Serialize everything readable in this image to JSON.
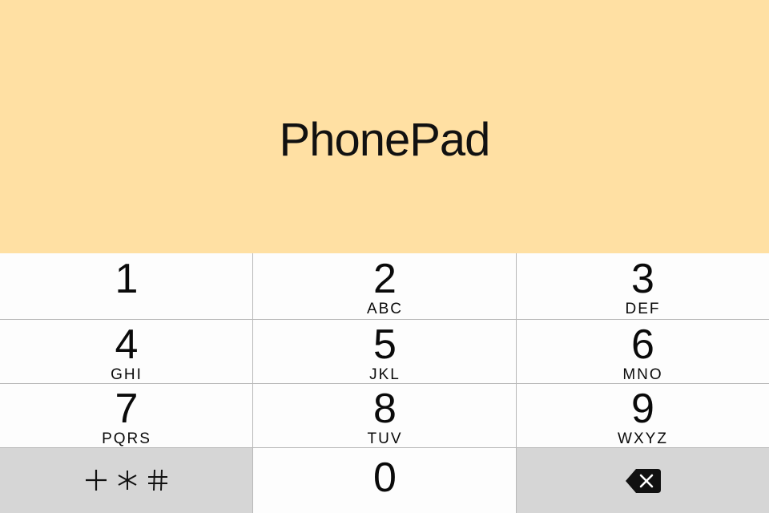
{
  "app": {
    "title": "PhonePad",
    "header_color": "#ffe0a3"
  },
  "keypad": {
    "keys": [
      {
        "digit": "1",
        "letters": ""
      },
      {
        "digit": "2",
        "letters": "ABC"
      },
      {
        "digit": "3",
        "letters": "DEF"
      },
      {
        "digit": "4",
        "letters": "GHI"
      },
      {
        "digit": "5",
        "letters": "JKL"
      },
      {
        "digit": "6",
        "letters": "MNO"
      },
      {
        "digit": "7",
        "letters": "PQRS"
      },
      {
        "digit": "8",
        "letters": "TUV"
      },
      {
        "digit": "9",
        "letters": "WXYZ"
      }
    ],
    "symbols_key": {
      "icons": [
        "plus-icon",
        "asterisk-icon",
        "hash-icon"
      ]
    },
    "zero_key": {
      "digit": "0"
    },
    "delete_key": {
      "icon": "backspace-icon"
    },
    "gray_key_color": "#d6d6d6"
  }
}
